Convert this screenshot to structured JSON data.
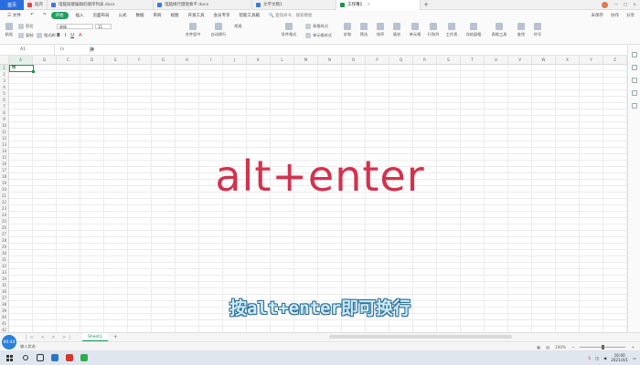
{
  "titlebar": {
    "home_label": "首页",
    "tabs": [
      {
        "label": "稻壳",
        "color": "#e5483b"
      },
      {
        "label": "电脑按键编辑的顺序列表.docx",
        "color": "#3a7be0"
      },
      {
        "label": "电脑换行键盘要不.docx",
        "color": "#3a7be0"
      },
      {
        "label": "文字文稿1",
        "color": "#3a7be0"
      },
      {
        "label": "工作簿1",
        "color": "#1e9150",
        "active": true
      }
    ],
    "right": [
      "未保存",
      "协作",
      "分享"
    ]
  },
  "menubar": {
    "file": "三 文件",
    "items": [
      "开始",
      "插入",
      "页面布局",
      "公式",
      "数据",
      "审阅",
      "视图",
      "开发工具",
      "会员专享",
      "智能工具箱"
    ],
    "search": "查找命令、搜索模板",
    "right": [
      "未保存",
      "协作",
      "分享"
    ]
  },
  "ribbon": {
    "paste": "粘贴",
    "cut": "剪切",
    "copy": "复制",
    "format_painter": "格式刷",
    "font_name": "宋体",
    "font_size": "11",
    "format_buttons": [
      "B",
      "I",
      "U",
      "A"
    ],
    "merge": "合并居中",
    "wrap": "自动换行",
    "number_format": "常规",
    "conditional": "条件格式",
    "table_style": "表格样式",
    "cell_style": "单元格样式",
    "sum": "求和",
    "filter": "筛选",
    "sort": "排序",
    "fill": "填充",
    "cell": "单元格",
    "row_col": "行和列",
    "worksheet": "工作表",
    "freeze": "冻结窗格",
    "table_tools": "表格工具",
    "find": "查找",
    "symbol": "符号"
  },
  "formulabar": {
    "cell_ref": "A1",
    "fx": "fx",
    "content": "换"
  },
  "grid": {
    "columns": [
      "A",
      "B",
      "C",
      "D",
      "E",
      "F",
      "G",
      "H",
      "I",
      "J",
      "K",
      "L",
      "M",
      "N",
      "O",
      "P",
      "Q",
      "R",
      "S",
      "T",
      "U",
      "V",
      "W",
      "X",
      "Y",
      "Z"
    ],
    "rows": [
      "1",
      "2",
      "3",
      "4",
      "5",
      "6",
      "7",
      "8",
      "9",
      "10",
      "11",
      "12",
      "13",
      "14",
      "15",
      "16",
      "17",
      "18",
      "19",
      "20",
      "21",
      "22",
      "23",
      "24",
      "25",
      "26",
      "27",
      "28",
      "29",
      "30",
      "31",
      "32",
      "33",
      "34",
      "35",
      "36",
      "37",
      "38",
      "39",
      "40",
      "41",
      "42"
    ],
    "active_cell_value": "换"
  },
  "overlay": {
    "main": "alt+enter",
    "sub": "按alt+enter即可换行",
    "main_color": "#d1334f"
  },
  "sheets": {
    "nav": "|< < > >|",
    "tabs": [
      "Sheet1"
    ],
    "add": "+"
  },
  "statusbar": {
    "left": "输入状态",
    "zoom": "100%",
    "timer": "00:44"
  },
  "taskbar": {
    "time": "16:00",
    "date": "2021/4/1"
  }
}
